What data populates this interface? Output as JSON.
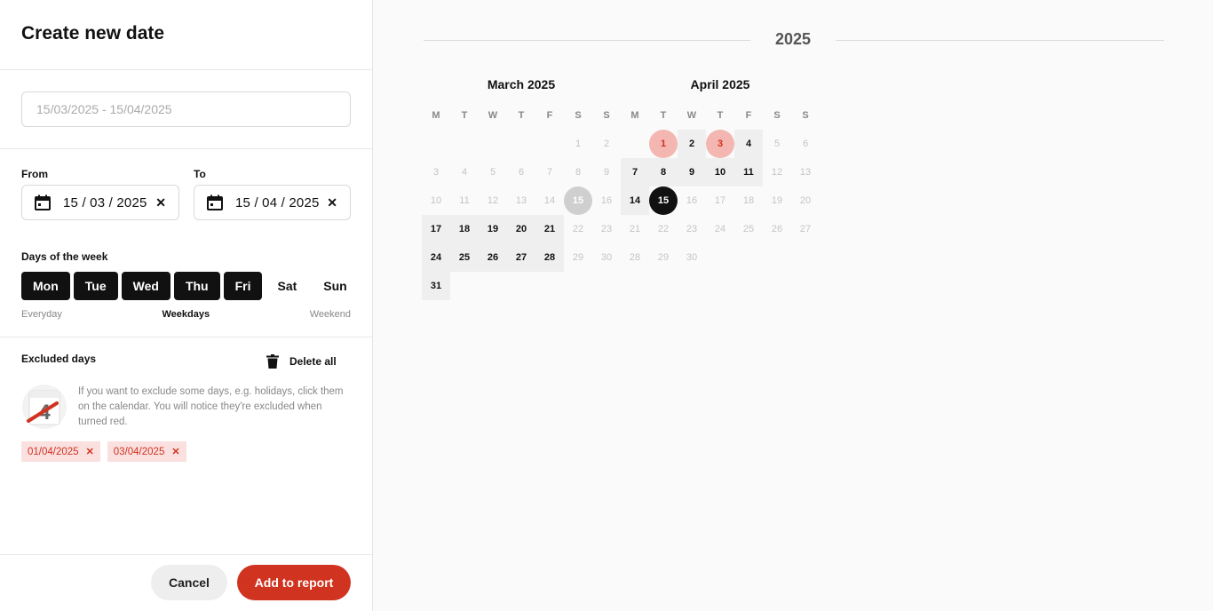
{
  "panel": {
    "title": "Create new date",
    "range_placeholder": "15/03/2025 - 15/04/2025",
    "from_label": "From",
    "to_label": "To",
    "from_value": "15 / 03 / 2025",
    "to_value": "15 / 04 / 2025",
    "clear_glyph": "✕",
    "days_label": "Days of the week",
    "days": [
      {
        "label": "Mon",
        "active": true
      },
      {
        "label": "Tue",
        "active": true
      },
      {
        "label": "Wed",
        "active": true
      },
      {
        "label": "Thu",
        "active": true
      },
      {
        "label": "Fri",
        "active": true
      },
      {
        "label": "Sat",
        "active": false
      },
      {
        "label": "Sun",
        "active": false
      }
    ],
    "presets": {
      "everyday": "Everyday",
      "weekdays": "Weekdays",
      "weekend": "Weekend"
    },
    "excluded_label": "Excluded days",
    "delete_all": "Delete all",
    "hint": "If you want to exclude some days, e.g. holidays, click them on the calendar. You will notice they're excluded when turned red.",
    "excluded_dates": [
      "01/04/2025",
      "03/04/2025"
    ],
    "cancel": "Cancel",
    "add": "Add to report",
    "accent_color": "#d0331f"
  },
  "calendar": {
    "year": "2025",
    "weekday_headers": [
      "M",
      "T",
      "W",
      "T",
      "F",
      "S",
      "S"
    ],
    "months": [
      {
        "title": "March 2025",
        "rows": [
          [
            null,
            null,
            null,
            null,
            null,
            1,
            2
          ],
          [
            3,
            4,
            5,
            6,
            7,
            8,
            9
          ],
          [
            10,
            11,
            12,
            13,
            14,
            15,
            16
          ],
          [
            17,
            18,
            19,
            20,
            21,
            22,
            23
          ],
          [
            24,
            25,
            26,
            27,
            28,
            29,
            30
          ],
          [
            31,
            null,
            null,
            null,
            null,
            null,
            null
          ]
        ],
        "selected": [
          17,
          18,
          19,
          20,
          21,
          24,
          25,
          26,
          27,
          28,
          31
        ],
        "range_start": 15,
        "excluded": []
      },
      {
        "title": "April 2025",
        "rows": [
          [
            null,
            1,
            2,
            3,
            4,
            5,
            6
          ],
          [
            7,
            8,
            9,
            10,
            11,
            12,
            13
          ],
          [
            14,
            15,
            16,
            17,
            18,
            19,
            20
          ],
          [
            21,
            22,
            23,
            24,
            25,
            26,
            27
          ],
          [
            28,
            29,
            30,
            null,
            null,
            null,
            null
          ]
        ],
        "selected": [
          2,
          4,
          7,
          8,
          9,
          10,
          11,
          14
        ],
        "range_end": 15,
        "excluded": [
          1,
          3
        ]
      }
    ]
  }
}
